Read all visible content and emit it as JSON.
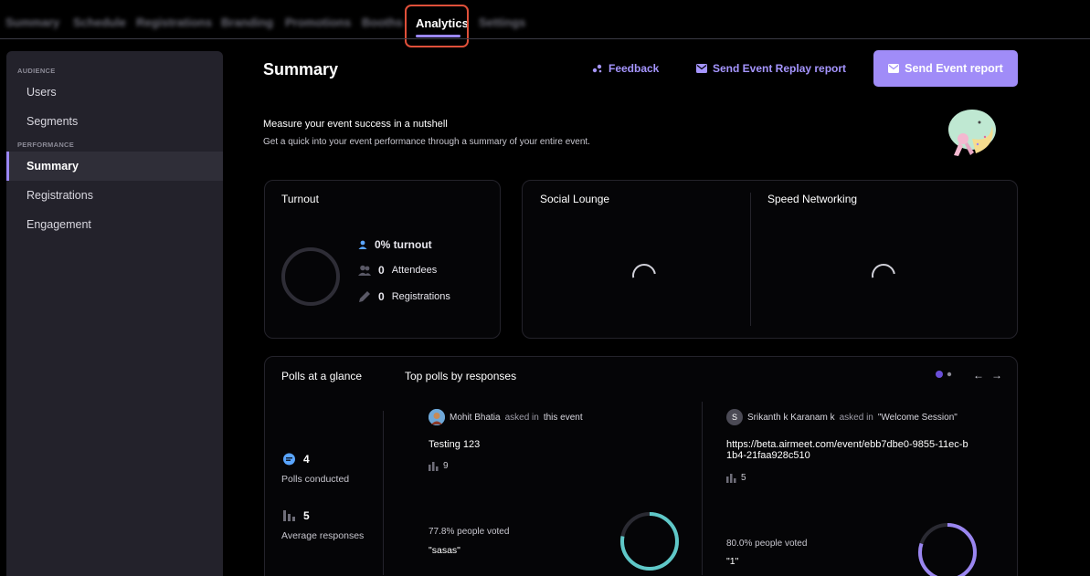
{
  "topnav": {
    "tabs": [
      "Summary",
      "Schedule",
      "Registrations",
      "Branding",
      "Promotions",
      "Booths",
      "Analytics",
      "Settings"
    ],
    "active_tab": "Analytics"
  },
  "sidebar": {
    "audience_label": "AUDIENCE",
    "performance_label": "PERFORMANCE",
    "items": [
      "Users",
      "Segments",
      "Summary",
      "Registrations",
      "Engagement"
    ],
    "active_item": "Summary"
  },
  "header": {
    "title": "Summary",
    "feedback": "Feedback",
    "replay_report": "Send Event Replay report",
    "event_report": "Send Event report"
  },
  "intro": {
    "heading": "Measure your event success in a nutshell",
    "subtext": "Get a quick into your event performance through a summary of your entire event."
  },
  "turnout": {
    "title": "Turnout",
    "turnout_text": "0% turnout",
    "attendees_count": "0",
    "attendees_label": "Attendees",
    "registrations_count": "0",
    "registrations_label": "Registrations"
  },
  "lounge": {
    "social_title": "Social Lounge",
    "networking_title": "Speed Networking"
  },
  "polls": {
    "title": "Polls at a glance",
    "top_title": "Top polls by responses",
    "conducted_count": "4",
    "conducted_label": "Polls conducted",
    "avg_count": "5",
    "avg_label": "Average responses",
    "items": [
      {
        "author": "Mohit Bhatia",
        "asked_in": "asked in",
        "location": "this event",
        "question": "Testing 123",
        "responses": "9",
        "voted": "77.8% people voted",
        "option": "\"sasas\"",
        "ring_color": "#5fc8c8"
      },
      {
        "avatar_letter": "S",
        "author": "Srikanth k Karanam k",
        "asked_in": "asked in",
        "location": "\"Welcome Session\"",
        "question": "https://beta.airmeet.com/event/ebb7dbe0-9855-11ec-b1b4-21faa928c510",
        "responses": "5",
        "voted": "80.0% people voted",
        "option": "\"1\"",
        "ring_color": "#9a86f0"
      }
    ]
  },
  "colors": {
    "accent": "#9b87f5",
    "button": "#a08cf8",
    "highlight": "#e0503a",
    "link": "#a595ff"
  }
}
